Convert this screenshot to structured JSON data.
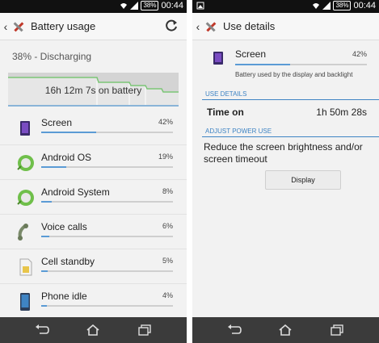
{
  "status_bar": {
    "time": "00:44",
    "battery_pct": "38%"
  },
  "left": {
    "title": "Battery usage",
    "status": "38% - Discharging",
    "graph_label": "16h 12m 7s on battery",
    "items": [
      {
        "name": "Screen",
        "pct": "42%",
        "level": 0.42,
        "icon": "screen-icon"
      },
      {
        "name": "Android OS",
        "pct": "19%",
        "level": 0.19,
        "icon": "android-os-icon"
      },
      {
        "name": "Android System",
        "pct": "8%",
        "level": 0.08,
        "icon": "android-system-icon"
      },
      {
        "name": "Voice calls",
        "pct": "6%",
        "level": 0.06,
        "icon": "phone-handset-icon"
      },
      {
        "name": "Cell standby",
        "pct": "5%",
        "level": 0.05,
        "icon": "sim-card-icon"
      },
      {
        "name": "Phone idle",
        "pct": "4%",
        "level": 0.04,
        "icon": "phone-icon"
      }
    ]
  },
  "right": {
    "title": "Use details",
    "item_name": "Screen",
    "item_pct": "42%",
    "item_level": 0.42,
    "item_desc": "Battery used by the display and backlight",
    "section_use": "USE DETAILS",
    "time_on_label": "Time on",
    "time_on_value": "1h 50m 28s",
    "section_adjust": "ADJUST POWER USE",
    "advice": "Reduce the screen brightness and/or screen timeout",
    "button": "Display"
  },
  "colors": {
    "accent": "#3f84c4",
    "bar": "#5b9bd5",
    "navbar": "#3b3b3b",
    "statusbar": "#111111"
  }
}
